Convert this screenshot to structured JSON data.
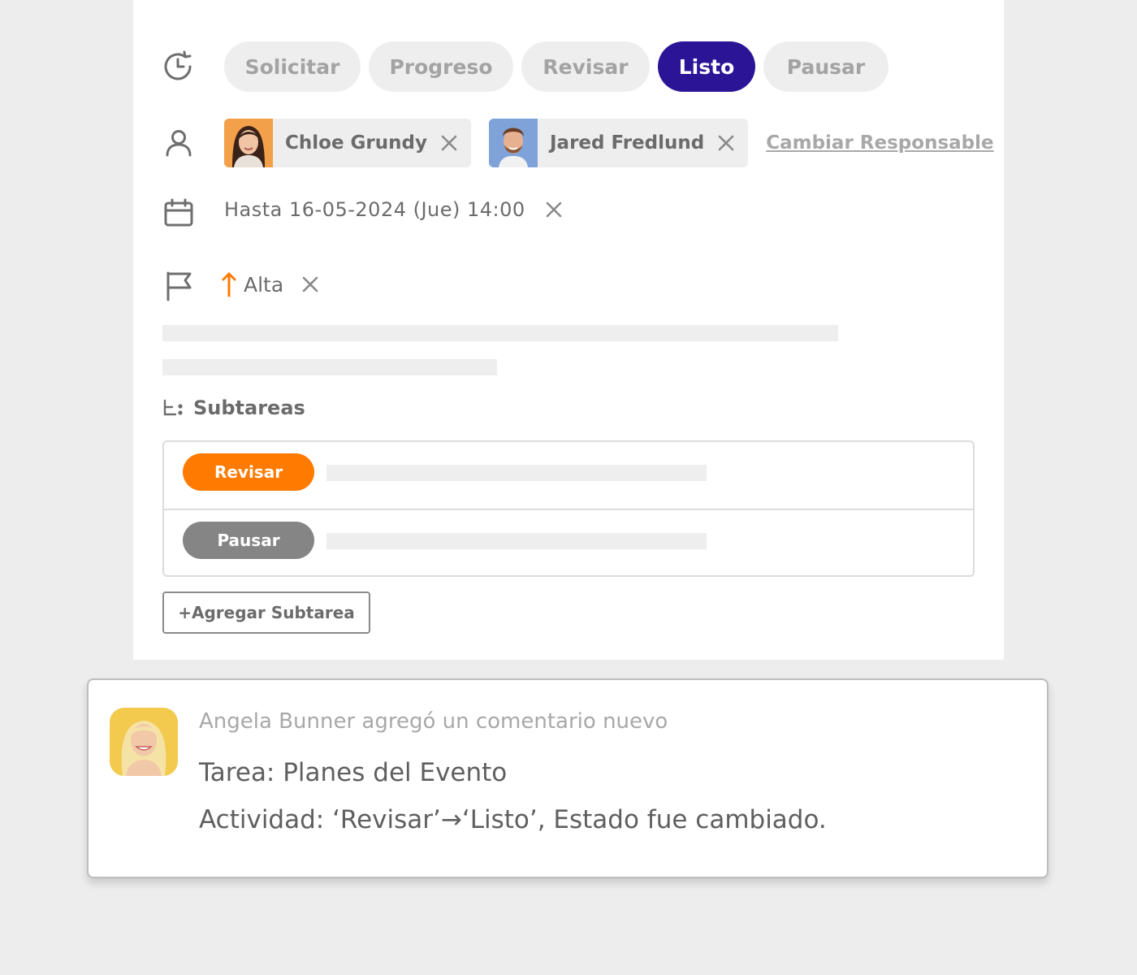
{
  "status": {
    "options": [
      "Solicitar",
      "Progreso",
      "Revisar",
      "Listo",
      "Pausar"
    ],
    "selected": "Listo",
    "active_color": "#2c1496"
  },
  "assignees": {
    "people": [
      {
        "name": "Chloe Grundy"
      },
      {
        "name": "Jared Fredlund"
      }
    ],
    "change_link": "Cambiar Responsable"
  },
  "due": {
    "text": "Hasta 16-05-2024 (Jue) 14:00"
  },
  "priority": {
    "label": "Alta",
    "color": "#ff7a00"
  },
  "subtasks": {
    "title": "Subtareas",
    "items": [
      {
        "status": "Revisar",
        "color": "#ff7a00"
      },
      {
        "status": "Pausar",
        "color": "#858585"
      }
    ],
    "add_label": "+Agregar Subtarea"
  },
  "notification": {
    "headline": "Angela Bunner agregó un comentario nuevo",
    "task": "Tarea: Planes del Evento",
    "activity": "Actividad: ‘Revisar’→‘Listo’, Estado fue cambiado."
  }
}
